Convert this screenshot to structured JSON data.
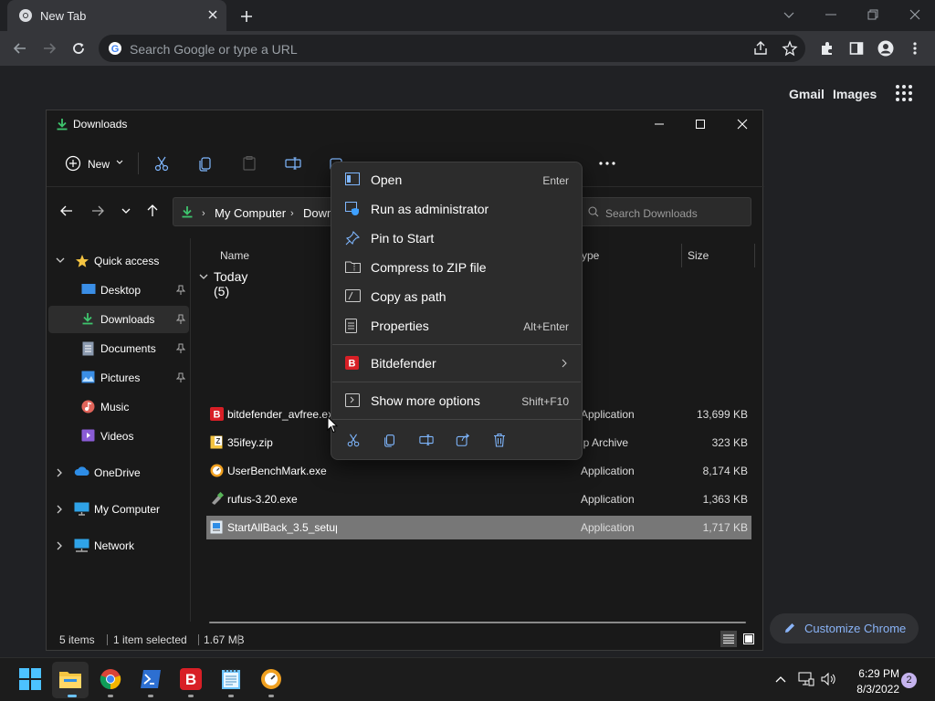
{
  "browser": {
    "tab_title": "New Tab",
    "omnibox_placeholder": "Search Google or type a URL",
    "ntp": {
      "gmail": "Gmail",
      "images": "Images",
      "customize": "Customize Chrome"
    }
  },
  "explorer": {
    "window_title": "Downloads",
    "commands": {
      "new_label": "New"
    },
    "address": {
      "seg1": "My Computer",
      "seg2": "Down"
    },
    "search_placeholder": "Search Downloads",
    "navpane": {
      "quick_access": "Quick access",
      "desktop": "Desktop",
      "downloads": "Downloads",
      "documents": "Documents",
      "pictures": "Pictures",
      "music": "Music",
      "videos": "Videos",
      "onedrive": "OneDrive",
      "my_computer": "My Computer",
      "network": "Network"
    },
    "columns": {
      "name": "Name",
      "type": "ype",
      "size": "Size"
    },
    "group": "Today (5)",
    "files": [
      {
        "name": "bitdefender_avfree.ex",
        "type": "Application",
        "size": "13,699 KB"
      },
      {
        "name": "35ifey.zip",
        "type": "ip Archive",
        "size": "323 KB"
      },
      {
        "name": "UserBenchMark.exe",
        "type": "Application",
        "size": "8,174 KB"
      },
      {
        "name": "rufus-3.20.exe",
        "type": "Application",
        "size": "1,363 KB"
      },
      {
        "name": "StartAllBack_3.5_setup",
        "type": "Application",
        "size": "1,717 KB"
      }
    ],
    "status": {
      "items": "5 items",
      "selected": "1 item selected",
      "size": "1.67 MB"
    }
  },
  "context_menu": {
    "open": "Open",
    "open_kb": "Enter",
    "run_admin": "Run as administrator",
    "pin_start": "Pin to Start",
    "compress": "Compress to ZIP file",
    "copy_path": "Copy as path",
    "properties": "Properties",
    "properties_kb": "Alt+Enter",
    "bitdefender": "Bitdefender",
    "more_options": "Show more options",
    "more_kb": "Shift+F10"
  },
  "taskbar": {
    "time": "6:29 PM",
    "date": "8/3/2022",
    "notifications": "2"
  },
  "colors": {
    "accent_blue": "#8ab4f8",
    "selection": "#777777",
    "bitdefender_red": "#d81f26",
    "folder_yellow": "#f5c542"
  }
}
